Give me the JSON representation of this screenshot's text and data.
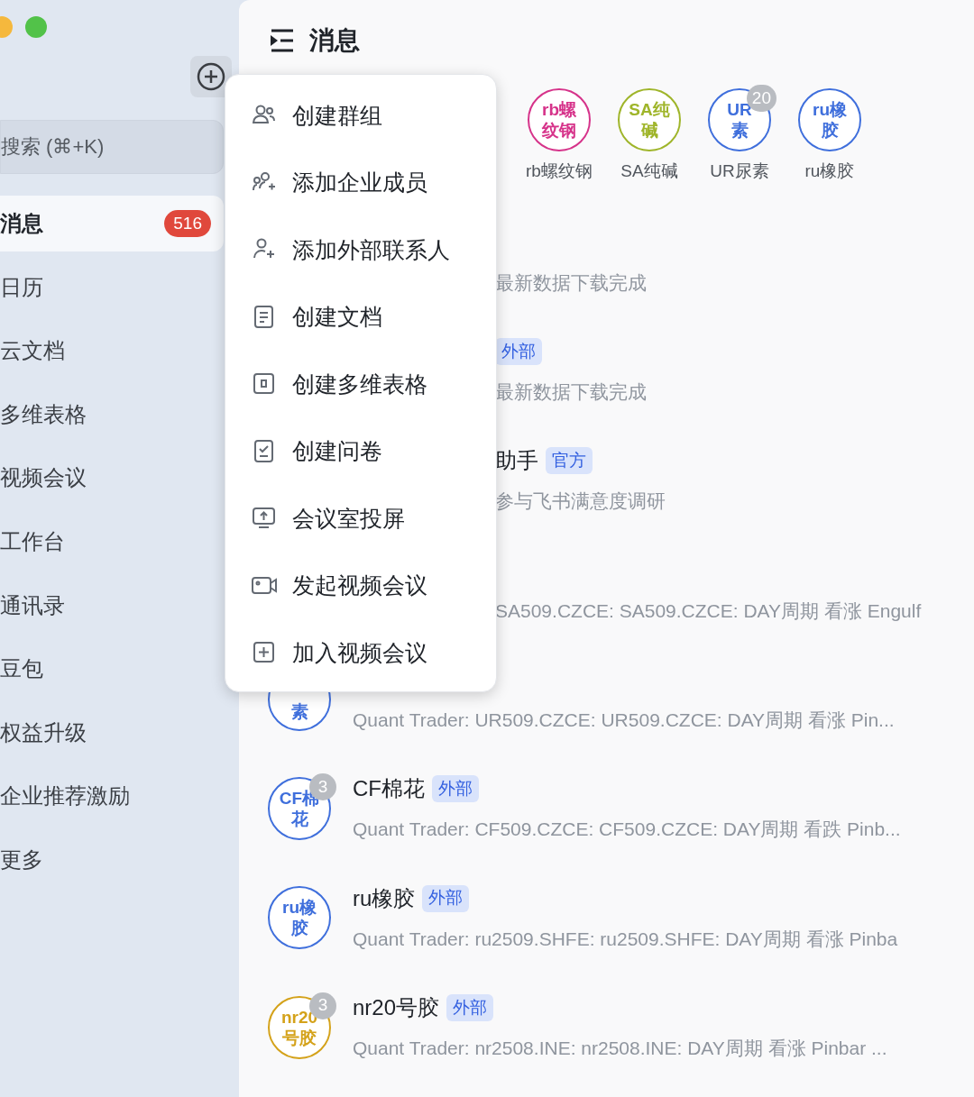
{
  "sidebar": {
    "search": {
      "placeholder": "搜索 (⌘+K)"
    },
    "items": [
      {
        "label": "消息",
        "selected": true,
        "badge": "516"
      },
      {
        "label": "日历",
        "selected": false
      },
      {
        "label": "云文档",
        "selected": false
      },
      {
        "label": "多维表格",
        "selected": false
      },
      {
        "label": "视频会议",
        "selected": false
      },
      {
        "label": "工作台",
        "selected": false
      },
      {
        "label": "通讯录",
        "selected": false
      },
      {
        "label": "豆包",
        "selected": false
      },
      {
        "label": "权益升级",
        "selected": false
      },
      {
        "label": "企业推荐激励",
        "selected": false
      },
      {
        "label": "更多",
        "selected": false
      }
    ]
  },
  "header": {
    "title": "消息"
  },
  "stories": [
    {
      "lines": [
        "rb螺",
        "纹钢"
      ],
      "name": "rb螺纹钢",
      "color": "#d6338a"
    },
    {
      "lines": [
        "SA纯",
        "碱"
      ],
      "name": "SA纯碱",
      "color": "#9fb52a"
    },
    {
      "lines": [
        "UR",
        "素"
      ],
      "name": "UR尿素",
      "color": "#3f6fdc",
      "badge": "20"
    },
    {
      "lines": [
        "ru橡",
        "胶"
      ],
      "name": "ru橡胶",
      "color": "#3f6fdc"
    }
  ],
  "chats": [
    {
      "covered": true,
      "subtitle": "最新数据下载完成"
    },
    {
      "covered": true,
      "tag": "外部",
      "subtitle": "最新数据下载完成"
    },
    {
      "covered": true,
      "title": "助手",
      "tag": "官方",
      "subtitle": "参与飞书满意度调研"
    },
    {
      "covered": true,
      "subtitle": "SA509.CZCE: SA509.CZCE: DAY周期 看涨 Engulf"
    },
    {
      "covered": false,
      "avatar": {
        "lines": [
          "素"
        ],
        "partial": true,
        "color": "#3f6fdc"
      },
      "subtitle": "Quant Trader: UR509.CZCE: UR509.CZCE: DAY周期 看涨 Pin..."
    },
    {
      "covered": false,
      "avatar": {
        "lines": [
          "CF棉",
          "花"
        ],
        "color": "#3f6fdc",
        "badge": "3"
      },
      "title": "CF棉花",
      "tag": "外部",
      "subtitle": "Quant Trader: CF509.CZCE: CF509.CZCE: DAY周期 看跌 Pinb..."
    },
    {
      "covered": false,
      "avatar": {
        "lines": [
          "ru橡",
          "胶"
        ],
        "color": "#3f6fdc"
      },
      "title": "ru橡胶",
      "tag": "外部",
      "subtitle": "Quant Trader: ru2509.SHFE: ru2509.SHFE: DAY周期 看涨 Pinba"
    },
    {
      "covered": false,
      "avatar": {
        "lines": [
          "nr20",
          "号胶"
        ],
        "color": "#d4a21a",
        "badge": "3"
      },
      "title": "nr20号胶",
      "tag": "外部",
      "subtitle": "Quant Trader: nr2508.INE: nr2508.INE: DAY周期 看涨 Pinbar ..."
    }
  ],
  "menu": {
    "items": [
      {
        "kind": "group",
        "label": "创建群组"
      },
      {
        "kind": "add-member",
        "label": "添加企业成员"
      },
      {
        "kind": "add-contact",
        "label": "添加外部联系人"
      },
      {
        "kind": "doc",
        "label": "创建文档"
      },
      {
        "kind": "table",
        "label": "创建多维表格"
      },
      {
        "kind": "survey",
        "label": "创建问卷"
      },
      {
        "kind": "screen",
        "label": "会议室投屏"
      },
      {
        "kind": "video",
        "label": "发起视频会议"
      },
      {
        "kind": "join",
        "label": "加入视频会议"
      }
    ]
  }
}
